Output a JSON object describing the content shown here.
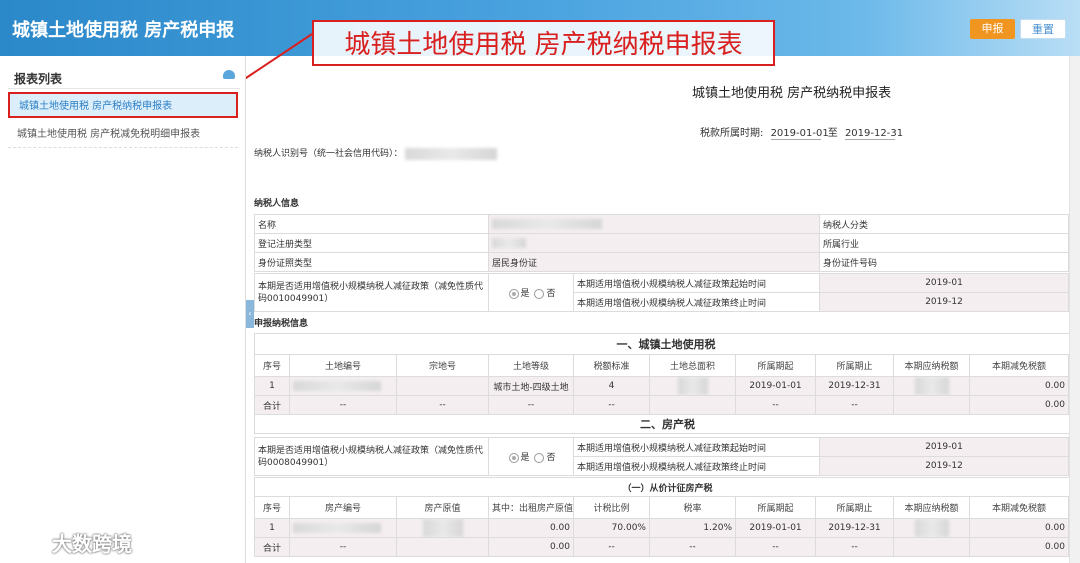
{
  "header": {
    "app_title": "城镇土地使用税 房产税申报",
    "callout": "城镇土地使用税 房产税纳税申报表",
    "submit_label": "申报",
    "reset_label": "重置"
  },
  "sidebar": {
    "title": "报表列表",
    "items": [
      {
        "label": "城镇土地使用税 房产税纳税申报表"
      },
      {
        "label": "城镇土地使用税 房产税减免税明细申报表"
      }
    ]
  },
  "form": {
    "title": "城镇土地使用税 房产税纳税申报表",
    "period_label": "税款所属时期:",
    "period_from": "2019-01-01",
    "period_sep": "至",
    "period_to": "2019-12-31",
    "taxid_label": "纳税人识别号（统一社会信用代码）："
  },
  "taxpayer": {
    "section": "纳税人信息",
    "name_label": "名称",
    "category_label": "纳税人分类",
    "category_value_partial": "单",
    "reg_type_label": "登记注册类型",
    "industry_label": "所属行业",
    "industry_value_partial": "计",
    "id_type_label": "身份证照类型",
    "id_type_value": "居民身份证",
    "id_no_label": "身份证件号码",
    "id_no_value_partial": "4",
    "policy_question": "本期是否适用增值税小规模纳税人减征政策（减免性质代码0010049901）",
    "yes": "是",
    "no": "否",
    "start_label": "本期适用增值税小规模纳税人减征政策起始时间",
    "start_value": "2019-01",
    "end_label": "本期适用增值税小规模纳税人减征政策终止时间",
    "end_value": "2019-12"
  },
  "declare": {
    "section": "申报纳税信息",
    "land_caption": "一、城镇土地使用税",
    "land_headers": [
      "序号",
      "土地编号",
      "宗地号",
      "土地等级",
      "税额标准",
      "土地总面积",
      "所属期起",
      "所属期止",
      "本期应纳税额",
      "本期减免税额"
    ],
    "land_row": [
      "1",
      "",
      "",
      "城市土地-四级土地",
      "4",
      "",
      "2019-01-01",
      "2019-12-31",
      "",
      "0.00"
    ],
    "land_total": [
      "合计",
      "--",
      "--",
      "--",
      "--",
      "",
      "--",
      "--",
      "",
      "0.00"
    ],
    "house_caption": "二、房产税",
    "house_policy_question": "本期是否适用增值税小规模纳税人减征政策（减免性质代码0008049901）",
    "house_start_value": "2019-01",
    "house_end_value": "2019-12",
    "price_caption": "（一）从价计征房产税",
    "house_headers": [
      "序号",
      "房产编号",
      "房产原值",
      "其中：出租房产原值",
      "计税比例",
      "税率",
      "所属期起",
      "所属期止",
      "本期应纳税额",
      "本期减免税额"
    ],
    "house_row": [
      "1",
      "",
      "",
      "0.00",
      "70.00%",
      "1.20%",
      "2019-01-01",
      "2019-12-31",
      "",
      "0.00"
    ],
    "house_total": [
      "合计",
      "--",
      "",
      "0.00",
      "--",
      "--",
      "--",
      "--",
      "",
      "0.00"
    ]
  },
  "watermark": "大数跨境"
}
